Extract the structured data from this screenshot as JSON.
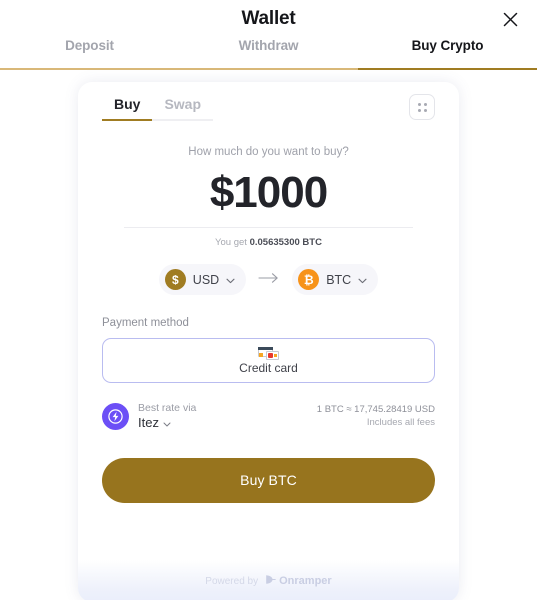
{
  "header": {
    "title": "Wallet",
    "close_icon": "close-icon"
  },
  "tabs": [
    {
      "label": "Deposit",
      "active": false
    },
    {
      "label": "Withdraw",
      "active": false
    },
    {
      "label": "Buy Crypto",
      "active": true
    }
  ],
  "widget": {
    "segments": [
      {
        "label": "Buy",
        "active": true
      },
      {
        "label": "Swap",
        "active": false
      }
    ],
    "grid_button_icon": "grid-dots-icon",
    "prompt": "How much do you want to buy?",
    "amount": "$1000",
    "you_get_prefix": "You get",
    "you_get_value": "0.05635300 BTC",
    "from_currency": {
      "symbol": "$",
      "code": "USD",
      "color": "#a07c22"
    },
    "to_currency": {
      "symbol": "₿",
      "code": "BTC",
      "color": "#f7931a"
    },
    "swap_arrow_icon": "arrow-right-icon",
    "payment_method_label": "Payment method",
    "payment_method_value": "Credit card",
    "payment_icon": "credit-card-icon",
    "provider": {
      "best_rate_label": "Best rate via",
      "name": "Itez",
      "icon": "lightning-bolt-icon",
      "rate": "1 BTC ≈ 17,745.28419 USD",
      "fees_note": "Includes all fees"
    },
    "cta_label": "Buy BTC",
    "footer": {
      "powered_by": "Powered by",
      "brand": "Onramper",
      "brand_icon": "onramper-logo-icon"
    }
  }
}
